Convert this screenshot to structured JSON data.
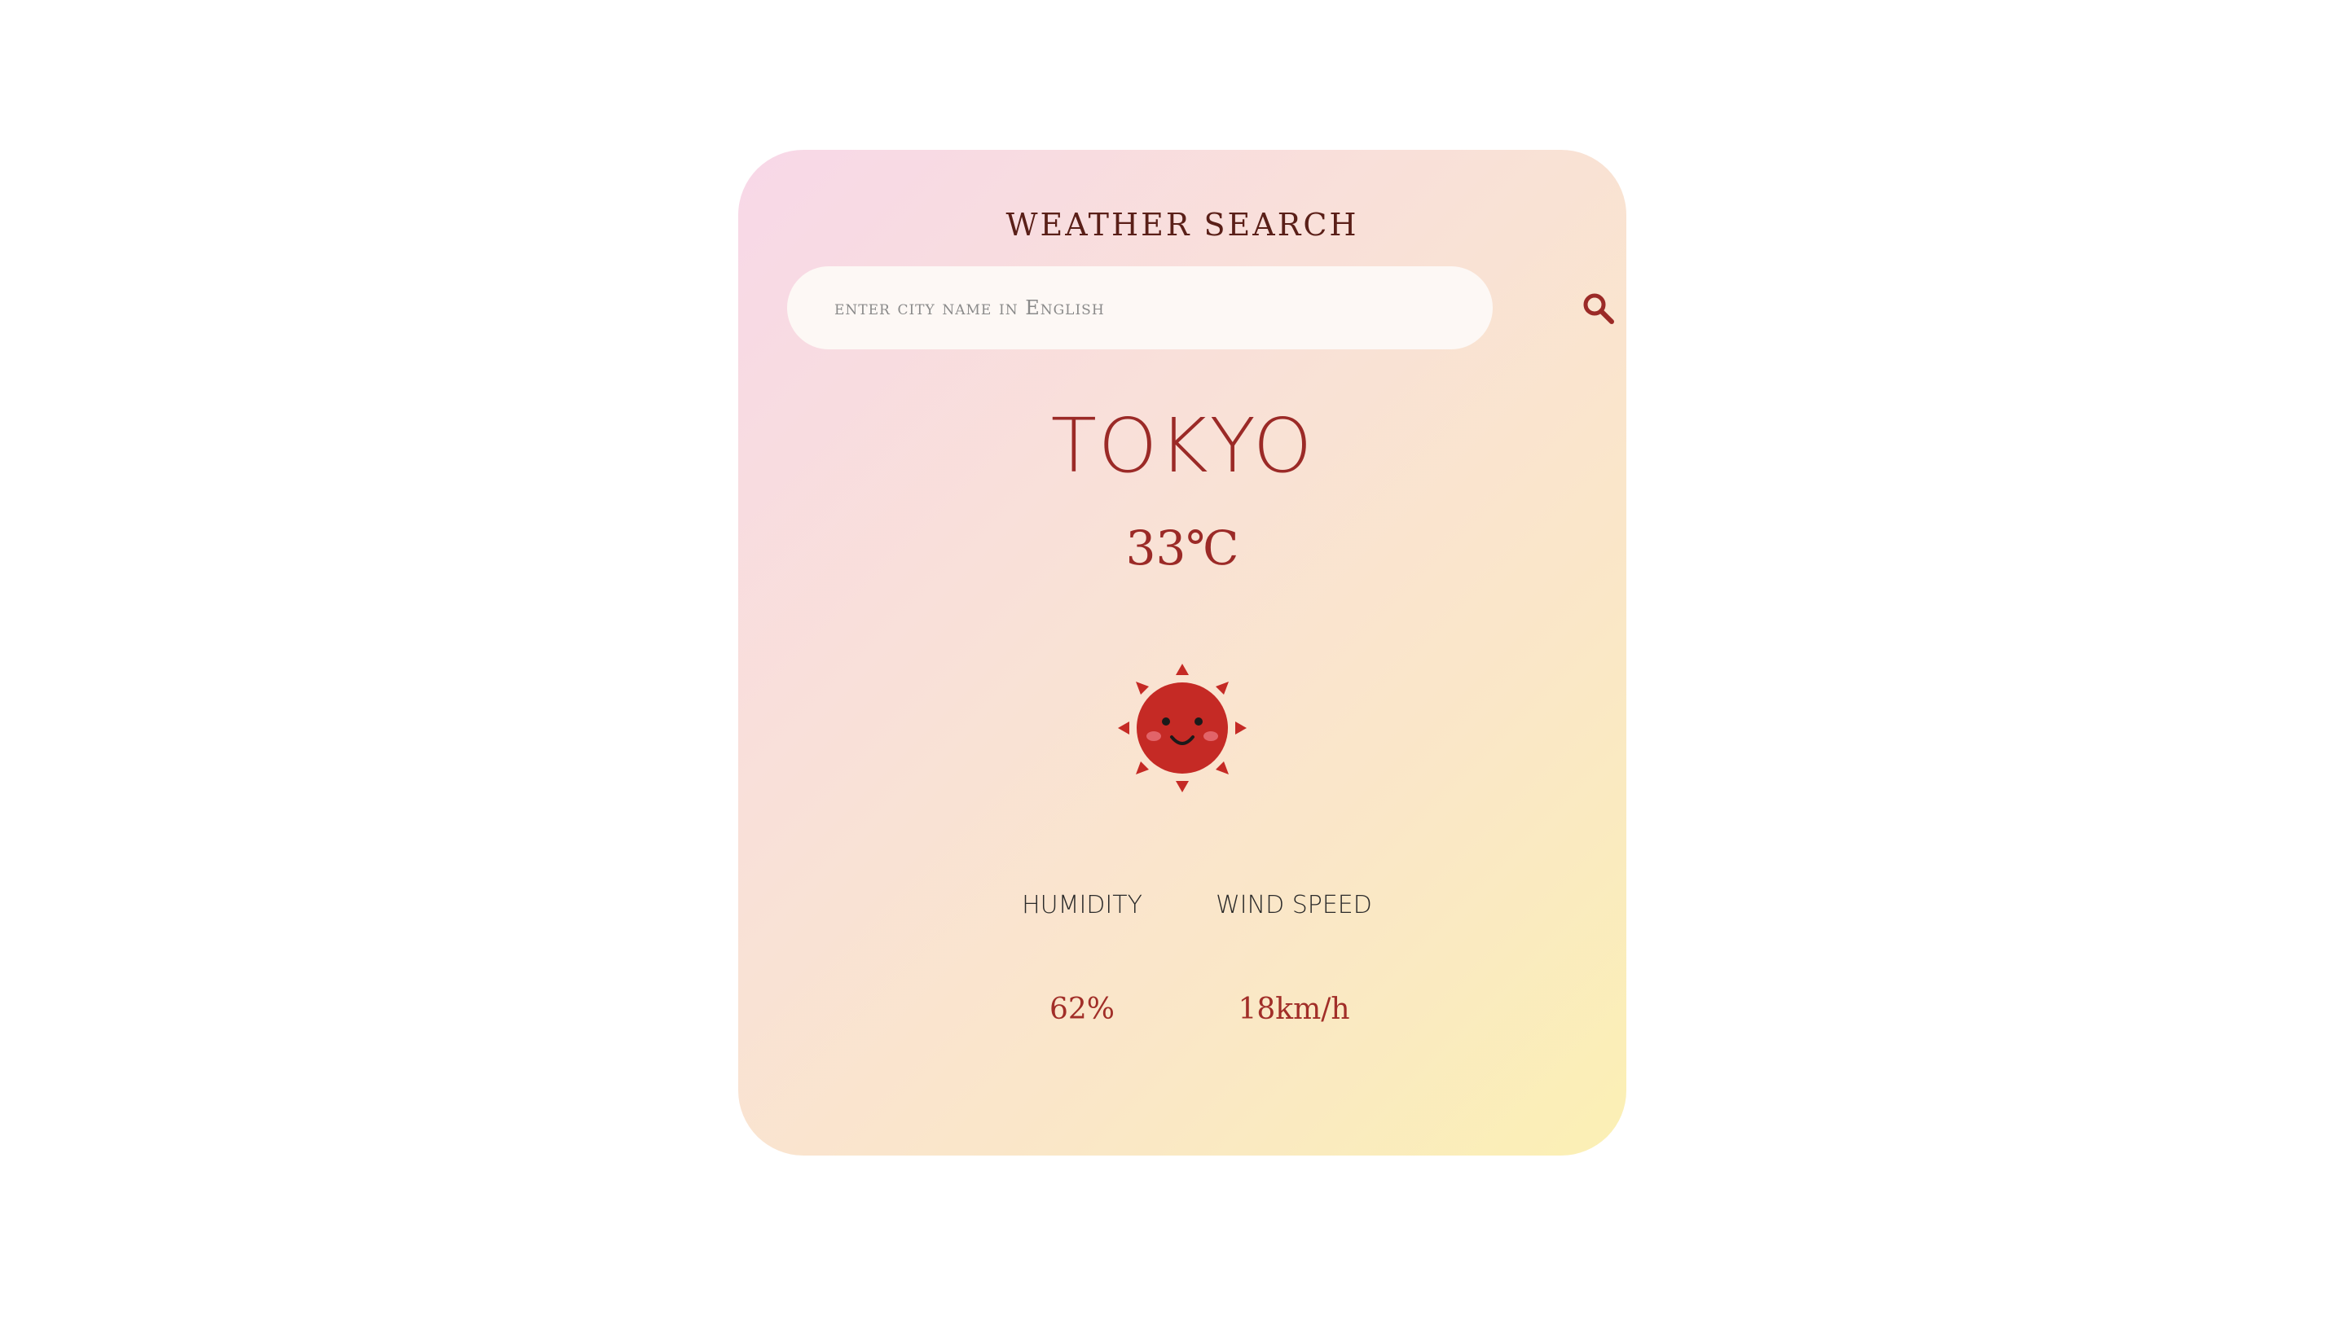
{
  "header": {
    "title": "Weather Search"
  },
  "search": {
    "placeholder": "enter city name in English",
    "button_icon": "search-icon"
  },
  "weather": {
    "city": "TOKYO",
    "temperature": "33℃",
    "condition_icon": "smiling-sun-icon"
  },
  "stats": {
    "humidity_label": "Humidity",
    "humidity_value": "62%",
    "wind_label": "Wind Speed",
    "wind_value": "18km/h"
  },
  "colors": {
    "accent": "#9b2a27",
    "sun": "#c52a25",
    "card_gradient_start": "#f8d8e8",
    "card_gradient_end": "#fbf0b4"
  }
}
